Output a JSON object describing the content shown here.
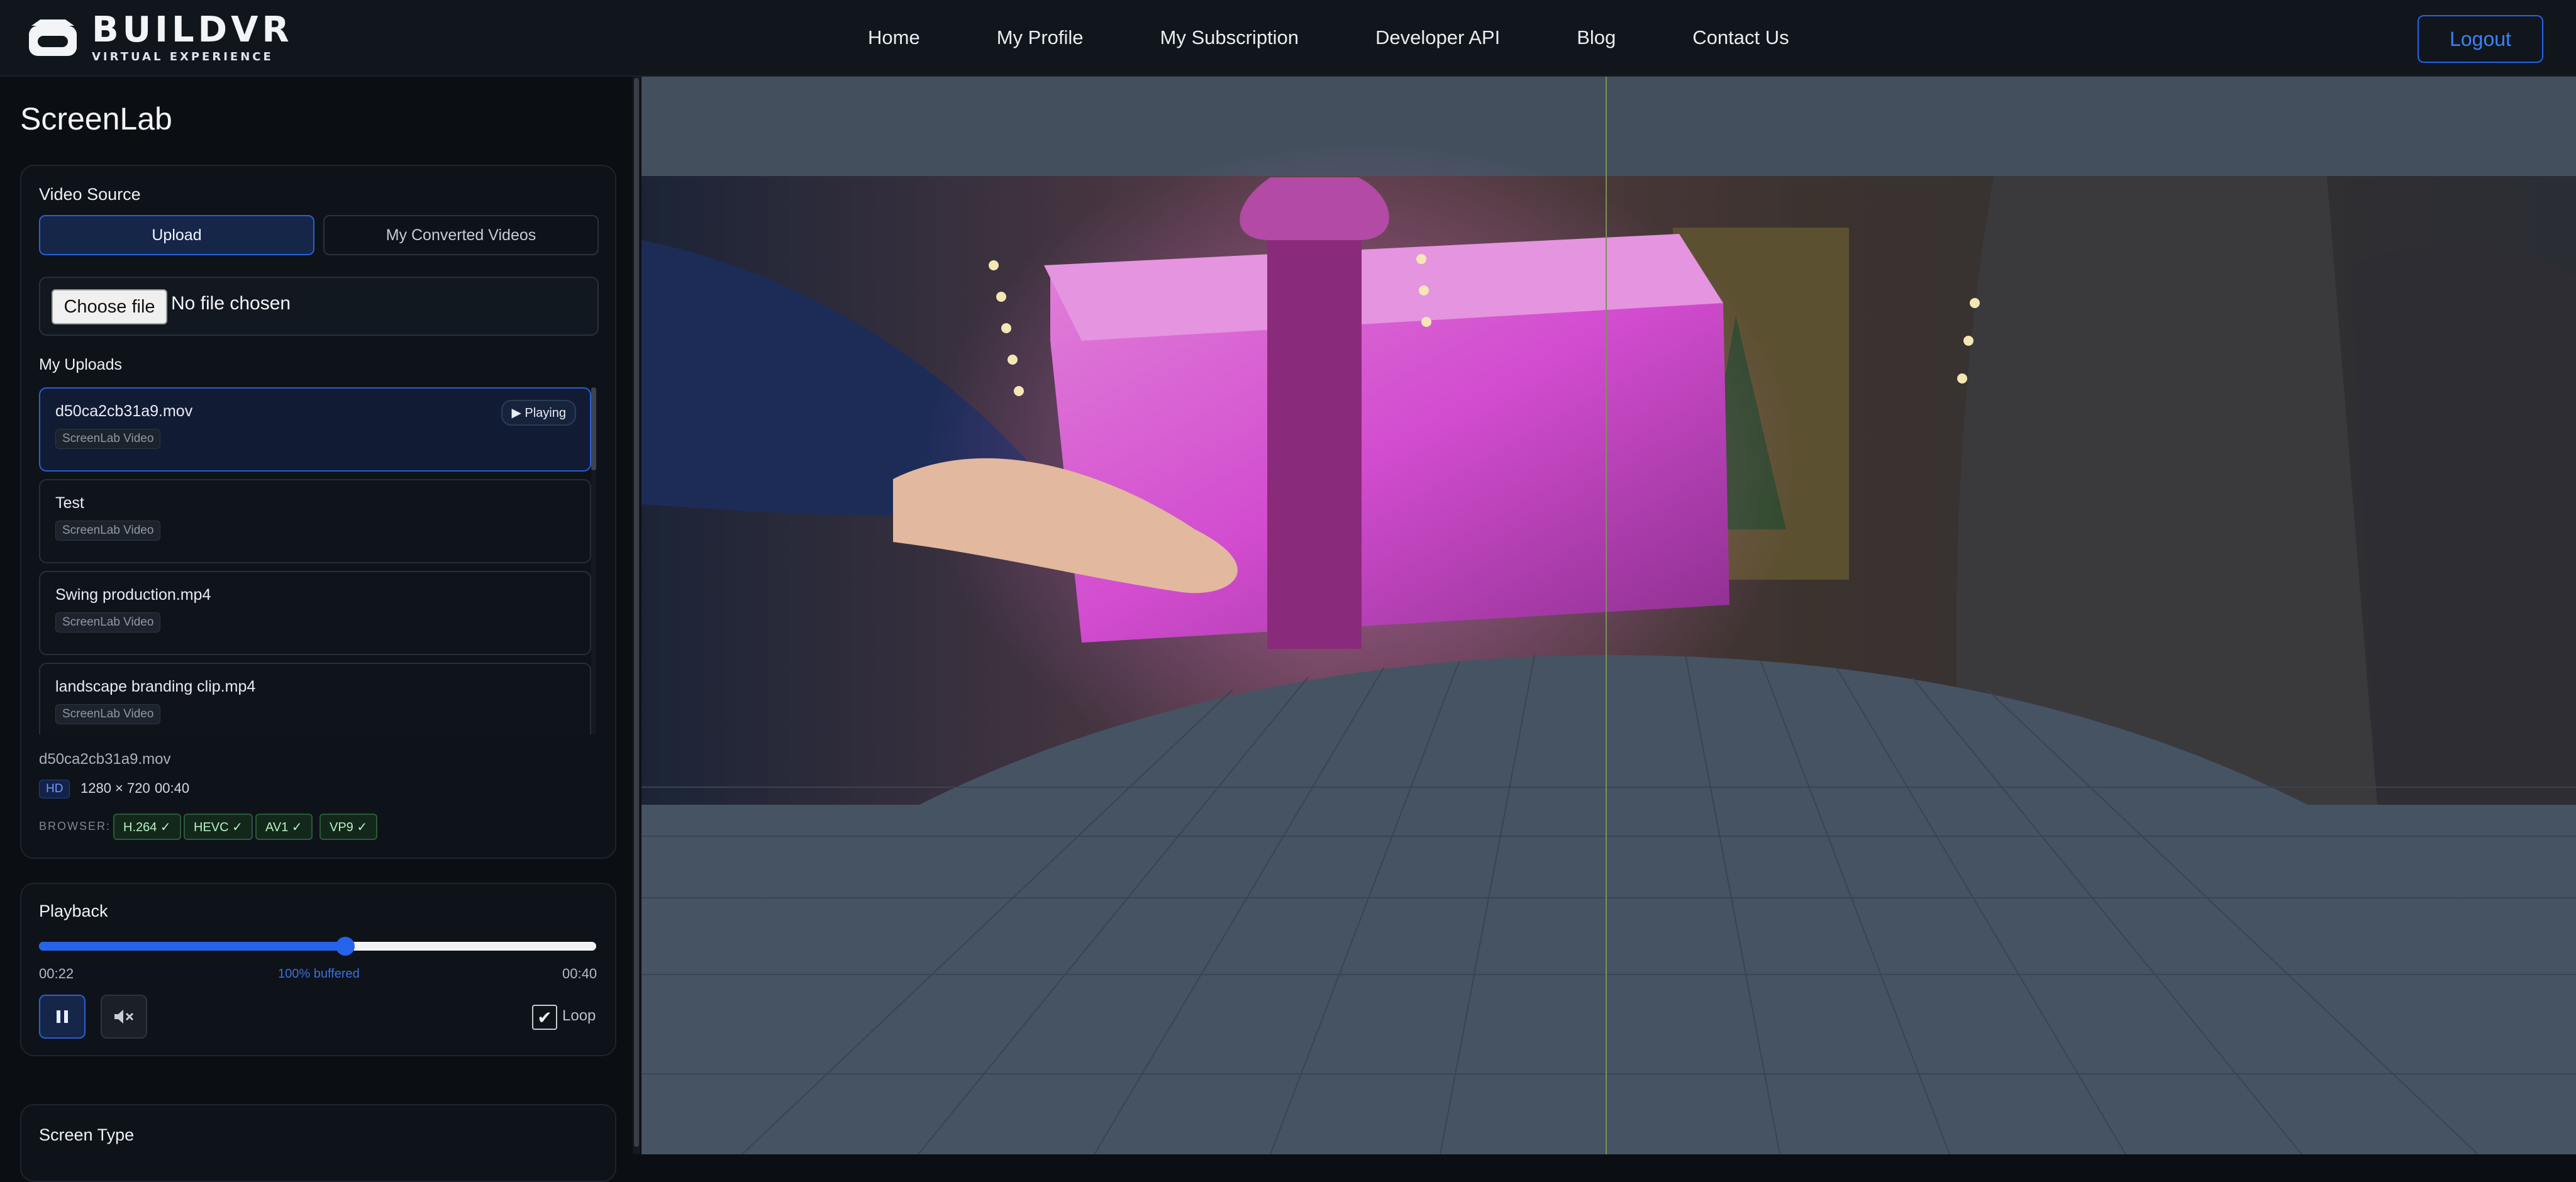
{
  "brand": {
    "name": "BUILDVR",
    "tagline": "VIRTUAL EXPERIENCE"
  },
  "nav": {
    "items": [
      "Home",
      "My Profile",
      "My Subscription",
      "Developer API",
      "Blog",
      "Contact Us"
    ],
    "logout": "Logout"
  },
  "app": {
    "title": "ScreenLab"
  },
  "video_source": {
    "label": "Video Source",
    "tabs": [
      "Upload",
      "My Converted Videos"
    ],
    "active_tab": "Upload",
    "file_button": "Choose file",
    "file_status": "No file chosen"
  },
  "uploads": {
    "label": "My Uploads",
    "items": [
      {
        "name": "d50ca2cb31a9.mov",
        "tag": "ScreenLab Video",
        "status": "Playing",
        "active": true
      },
      {
        "name": "Test",
        "tag": "ScreenLab Video"
      },
      {
        "name": "Swing production.mp4",
        "tag": "ScreenLab Video"
      },
      {
        "name": "landscape branding clip.mp4",
        "tag": "ScreenLab Video"
      }
    ]
  },
  "selected": {
    "name": "d50ca2cb31a9.mov",
    "quality": "HD",
    "resolution": "1280 × 720",
    "duration": "00:40",
    "browser_label": "BROWSER:",
    "codecs": [
      "H.264 ✓",
      "HEVC ✓",
      "AV1 ✓",
      "VP9 ✓"
    ]
  },
  "playback": {
    "label": "Playback",
    "current": "00:22",
    "end": "00:40",
    "buffered": "100% buffered",
    "progress": 0.55,
    "loop_label": "Loop",
    "loop_checked": true
  },
  "screen_type": {
    "label": "Screen Type"
  },
  "colors": {
    "accent": "#2563eb",
    "background": "#0b0f14",
    "floor": "#465363"
  }
}
